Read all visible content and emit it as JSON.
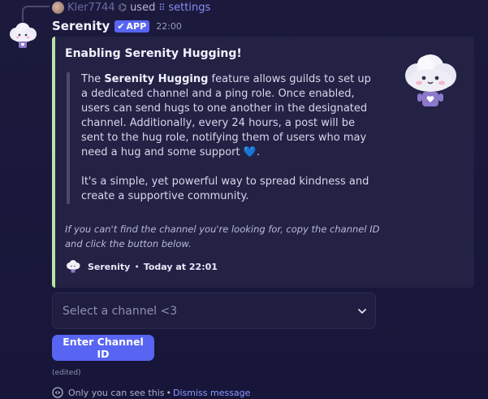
{
  "reply": {
    "username": "Kler7744",
    "used_text": "used",
    "command": "settings"
  },
  "message": {
    "author": "Serenity",
    "badge": "APP",
    "timestamp": "22:00"
  },
  "embed": {
    "title": "Enabling Serenity Hugging!",
    "intro_before": "The ",
    "intro_bold": "Serenity Hugging",
    "intro_after": " feature allows guilds to set up a dedicated channel and a ping role. Once enabled, users can send hugs to one another in the designated channel. Additionally, every 24 hours, a post will be sent to the hug role, notifying them of users who may need a hug and some support",
    "heart_emoji": "💙",
    "period": ".",
    "paragraph2": "It's a simple, yet powerful way to spread kindness and create a supportive community.",
    "note": "If you can't find the channel you're looking for, copy the channel ID and click the button below.",
    "footer_name": "Serenity",
    "footer_separator": "•",
    "footer_time": "Today at 22:01"
  },
  "select": {
    "placeholder": "Select a channel <3"
  },
  "button": {
    "label": "Enter Channel ID"
  },
  "edited_label": "(edited)",
  "ephemeral": {
    "text": "Only you can see this",
    "separator": "•",
    "dismiss": "Dismiss message"
  },
  "colors": {
    "accent": "#5865f2",
    "embed_border": "#b9e3a0",
    "link": "#8b9bff"
  }
}
